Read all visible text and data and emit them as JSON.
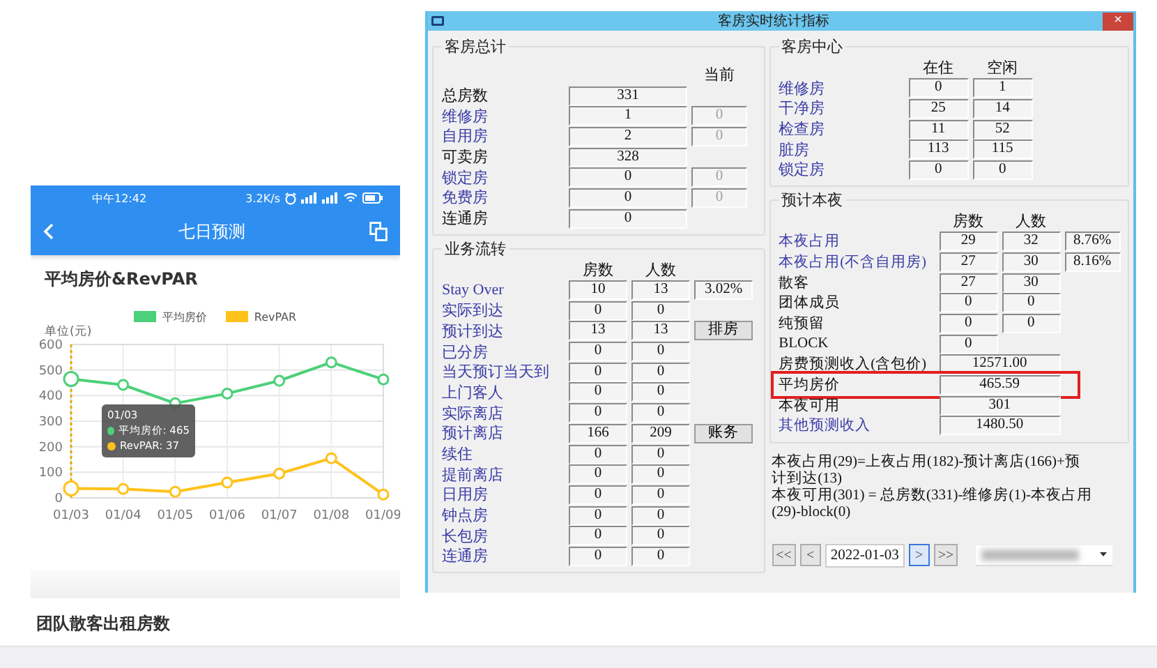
{
  "phone": {
    "status_time": "中午12:42",
    "net_speed": "3.2K/s",
    "title": "七日预测",
    "section_title": "平均房价&RevPAR",
    "chart_data": {
      "type": "line",
      "ylabel": "单位(元)",
      "categories": [
        "01/03",
        "01/04",
        "01/05",
        "01/06",
        "01/07",
        "01/08",
        "01/09"
      ],
      "ylim": [
        0,
        600
      ],
      "grid": true,
      "ref_lines": [
        {
          "axis": "x",
          "value": "01/03"
        }
      ],
      "yticks": [
        0,
        100,
        200,
        300,
        400,
        500,
        600
      ],
      "series": [
        {
          "name": "平均房价",
          "color": "#4cd07a",
          "marker": "circle",
          "values": [
            465,
            442,
            370,
            408,
            458,
            530,
            463
          ]
        },
        {
          "name": "RevPAR",
          "color": "#ffc21a",
          "marker": "circle",
          "values": [
            37,
            35,
            24,
            60,
            95,
            155,
            13
          ]
        }
      ]
    },
    "tooltip": {
      "title": "01/03",
      "items": [
        {
          "text": "平均房价: 465",
          "color": "#4cd07a"
        },
        {
          "text": "RevPAR: 37",
          "color": "#ffc21a"
        }
      ]
    },
    "next_section_title": "团队散客出租房数"
  },
  "window": {
    "title": "客房实时统计指标",
    "close": "×",
    "room_totals": {
      "title": "客房总计",
      "column": "当前",
      "rows": [
        {
          "label": "总房数",
          "link": false,
          "value": "331"
        },
        {
          "label": "维修房",
          "link": true,
          "value": "1",
          "current": "0"
        },
        {
          "label": "自用房",
          "link": true,
          "value": "2",
          "current": "0"
        },
        {
          "label": "可卖房",
          "link": false,
          "value": "328"
        },
        {
          "label": "锁定房",
          "link": true,
          "value": "0",
          "current": "0"
        },
        {
          "label": "免费房",
          "link": true,
          "value": "0",
          "current": "0"
        },
        {
          "label": "连通房",
          "link": false,
          "value": "0"
        }
      ]
    },
    "business_flow": {
      "title": "业务流转",
      "columns": [
        "房数",
        "人数"
      ],
      "rows": [
        {
          "label": "Stay Over",
          "link": true,
          "rooms": "10",
          "people": "13",
          "extra": "3.02%"
        },
        {
          "label": "实际到达",
          "link": true,
          "rooms": "0",
          "people": "0"
        },
        {
          "label": "预计到达",
          "link": true,
          "rooms": "13",
          "people": "13",
          "button": "排房"
        },
        {
          "label": "已分房",
          "link": true,
          "rooms": "0",
          "people": "0"
        },
        {
          "label": "当天预订当天到",
          "link": true,
          "rooms": "0",
          "people": "0"
        },
        {
          "label": "上门客人",
          "link": true,
          "rooms": "0",
          "people": "0"
        },
        {
          "label": "实际离店",
          "link": true,
          "rooms": "0",
          "people": "0"
        },
        {
          "label": "预计离店",
          "link": true,
          "rooms": "166",
          "people": "209",
          "button": "账务"
        },
        {
          "label": "续住",
          "link": true,
          "rooms": "0",
          "people": "0"
        },
        {
          "label": "提前离店",
          "link": true,
          "rooms": "0",
          "people": "0"
        },
        {
          "label": "日用房",
          "link": true,
          "rooms": "0",
          "people": "0"
        },
        {
          "label": "钟点房",
          "link": true,
          "rooms": "0",
          "people": "0"
        },
        {
          "label": "长包房",
          "link": true,
          "rooms": "0",
          "people": "0"
        },
        {
          "label": "连通房",
          "link": true,
          "rooms": "0",
          "people": "0"
        }
      ]
    },
    "room_center": {
      "title": "客房中心",
      "columns": [
        "在住",
        "空闲"
      ],
      "rows": [
        {
          "label": "维修房",
          "link": true,
          "rooms": "0",
          "people": "1"
        },
        {
          "label": "干净房",
          "link": true,
          "rooms": "25",
          "people": "14"
        },
        {
          "label": "检查房",
          "link": true,
          "rooms": "11",
          "people": "52"
        },
        {
          "label": "脏房",
          "link": true,
          "rooms": "113",
          "people": "115"
        },
        {
          "label": "锁定房",
          "link": true,
          "rooms": "0",
          "people": "0"
        }
      ]
    },
    "tonight": {
      "title": "预计本夜",
      "columns": [
        "房数",
        "人数"
      ],
      "rows": [
        {
          "kind": "pair",
          "label": "本夜占用",
          "link": true,
          "highlighted": false,
          "rooms": "29",
          "people": "32",
          "extra": "8.76%"
        },
        {
          "kind": "pair",
          "label": "本夜占用(不含自用房)",
          "link": true,
          "highlighted": false,
          "rooms": "27",
          "people": "30",
          "extra": "8.16%"
        },
        {
          "kind": "pair",
          "label": "散客",
          "link": false,
          "highlighted": false,
          "rooms": "27",
          "people": "30"
        },
        {
          "kind": "pair",
          "label": "团体成员",
          "link": false,
          "highlighted": false,
          "rooms": "0",
          "people": "0"
        },
        {
          "kind": "pair",
          "label": "纯预留",
          "link": false,
          "highlighted": false,
          "rooms": "0",
          "people": "0"
        },
        {
          "kind": "pair",
          "label": "BLOCK",
          "link": false,
          "highlighted": false,
          "rooms": "0"
        },
        {
          "kind": "total",
          "label": "房费预测收入(含包价)",
          "link": false,
          "highlighted": false,
          "value": "12571.00"
        },
        {
          "kind": "total",
          "label": "平均房价",
          "link": false,
          "highlighted": true,
          "value": "465.59"
        },
        {
          "kind": "total",
          "label": "本夜可用",
          "link": false,
          "highlighted": false,
          "value": "301"
        },
        {
          "kind": "total",
          "label": "其他预测收入",
          "link": true,
          "highlighted": false,
          "value": "1480.50"
        }
      ]
    },
    "notes": [
      "本夜占用(29)=上夜占用(182)-预计离店(166)+预计到达(13)",
      "本夜可用(301) = 总房数(331)-维修房(1)-本夜占用(29)-block(0)"
    ],
    "nav_buttons": [
      {
        "text": "<<",
        "focused": false
      },
      {
        "text": "<",
        "focused": false
      }
    ],
    "date": "2022-01-03",
    "nav_buttons_after": [
      {
        "text": ">",
        "focused": true
      },
      {
        "text": ">>",
        "focused": false
      }
    ]
  }
}
